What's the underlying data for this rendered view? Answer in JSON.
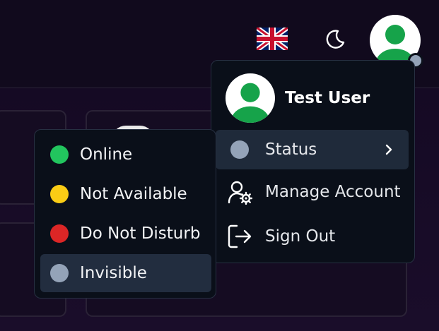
{
  "header": {
    "language_icon": "uk-flag-icon",
    "theme_icon": "moon-icon",
    "avatar_icon": "user-avatar-icon"
  },
  "account_menu": {
    "user_name": "Test User",
    "items": [
      {
        "label": "Status",
        "icon": "status-dot-icon",
        "submenu_icon": "chevron-right-icon"
      },
      {
        "label": "Manage Account",
        "icon": "user-gear-icon"
      },
      {
        "label": "Sign Out",
        "icon": "sign-out-icon"
      }
    ]
  },
  "status_menu": {
    "items": [
      {
        "label": "Online",
        "color": "#22c55e"
      },
      {
        "label": "Not Available",
        "color": "#facc15"
      },
      {
        "label": "Do Not Disturb",
        "color": "#dc2626"
      },
      {
        "label": "Invisible",
        "color": "#94a3b8",
        "selected": true
      }
    ]
  },
  "current_status_color": "#94a3b8"
}
